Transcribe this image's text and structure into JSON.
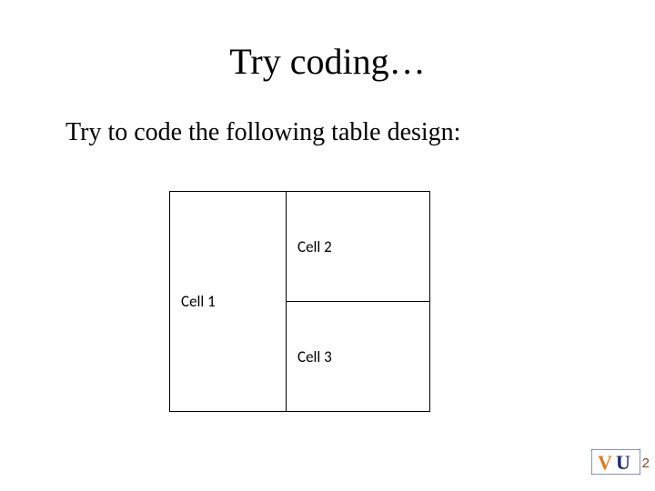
{
  "title": "Try coding…",
  "subtitle": "Try to code the following table design:",
  "table": {
    "cell1": "Cell 1",
    "cell2": "Cell 2",
    "cell3": "Cell 3"
  },
  "logo": {
    "text": "VU",
    "variant": "orange-blue"
  },
  "page_number": "2"
}
